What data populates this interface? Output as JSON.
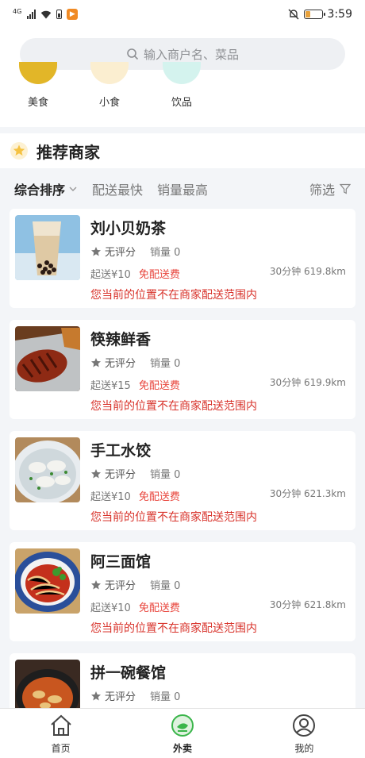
{
  "status_bar": {
    "signal_tag": "4G",
    "time": "3:59"
  },
  "search": {
    "placeholder": "输入商户名、菜品"
  },
  "categories": [
    {
      "label": "美食",
      "color": "#e2b628"
    },
    {
      "label": "小食",
      "color": "#fbeed0"
    },
    {
      "label": "饮品",
      "color": "#d4f3ee"
    }
  ],
  "recommend": {
    "title": "推荐商家"
  },
  "sort": {
    "items": [
      "综合排序",
      "配送最快",
      "销量最高"
    ],
    "filter": "筛选"
  },
  "merchants": [
    {
      "name": "刘小贝奶茶",
      "rating": "无评分",
      "sales": "销量 0",
      "min_order": "起送¥10",
      "free_delivery": "免配送费",
      "distance": "30分钟 619.8km",
      "warning": "您当前的位置不在商家配送范围内",
      "image": "milk-tea"
    },
    {
      "name": "筷辣鲜香",
      "rating": "无评分",
      "sales": "销量 0",
      "min_order": "起送¥15",
      "free_delivery": "免配送费",
      "distance": "30分钟 619.9km",
      "warning": "您当前的位置不在商家配送范围内",
      "image": "grilled-fish"
    },
    {
      "name": "手工水饺",
      "rating": "无评分",
      "sales": "销量 0",
      "min_order": "起送¥10",
      "free_delivery": "免配送费",
      "distance": "30分钟 621.3km",
      "warning": "您当前的位置不在商家配送范围内",
      "image": "dumplings"
    },
    {
      "name": "阿三面馆",
      "rating": "无评分",
      "sales": "销量 0",
      "min_order": "起送¥10",
      "free_delivery": "免配送费",
      "distance": "30分钟 621.8km",
      "warning": "您当前的位置不在商家配送范围内",
      "image": "noodles"
    },
    {
      "name": "拼一碗餐馆",
      "rating": "无评分",
      "sales": "销量 0",
      "image": "hotpot"
    }
  ],
  "tabs": [
    {
      "label": "首页",
      "icon": "home-icon"
    },
    {
      "label": "外卖",
      "icon": "takeout-icon"
    },
    {
      "label": "我的",
      "icon": "profile-icon"
    }
  ],
  "colors": {
    "accent": "#3ab54a",
    "warning": "#d8332b",
    "free": "#e8453c",
    "star": "#f5c242"
  }
}
